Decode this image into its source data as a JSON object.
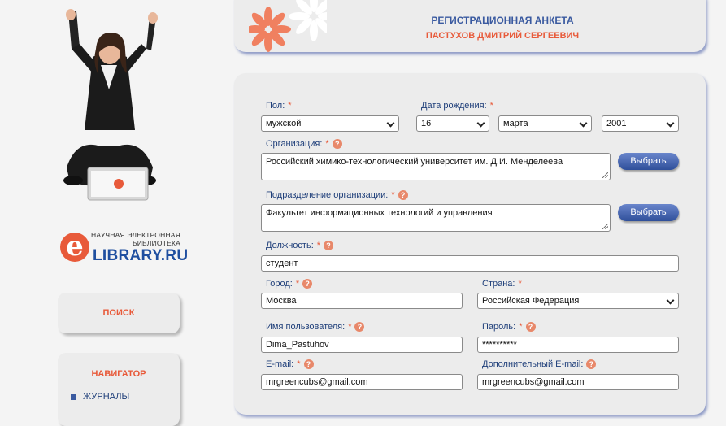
{
  "sidebar": {
    "logo_small_line1": "НАУЧНАЯ ЭЛЕКТРОННАЯ",
    "logo_small_line2": "БИБЛИОТЕКА",
    "logo_brand": "LIBRARY.RU",
    "logo_letter": "e",
    "search_title": "ПОИСК",
    "navigator_title": "НАВИГАТОР",
    "nav_items": [
      {
        "label": "ЖУРНАЛЫ"
      }
    ]
  },
  "header": {
    "title": "РЕГИСТРАЦИОННАЯ АНКЕТА",
    "name": "ПАСТУХОВ ДМИТРИЙ СЕРГЕЕВИЧ"
  },
  "form": {
    "gender_label": "Пол:",
    "gender_value": "мужской",
    "birthdate_label": "Дата рождения:",
    "birth_day": "16",
    "birth_month": "марта",
    "birth_year": "2001",
    "org_label": "Организация:",
    "org_value": "Российский химико-технологический университет им. Д.И. Менделеева",
    "dept_label": "Подразделение организации:",
    "dept_value": "Факультет информационных технологий и управления",
    "select_button": "Выбрать",
    "position_label": "Должность:",
    "position_value": "студент",
    "city_label": "Город:",
    "city_value": "Москва",
    "country_label": "Страна:",
    "country_value": "Российская Федерация",
    "username_label": "Имя пользователя:",
    "username_value": "Dima_Pastuhov",
    "password_label": "Пароль:",
    "password_value": "**********",
    "email_label": "E-mail:",
    "email_value": "mrgreencubs@gmail.com",
    "extra_email_label": "Дополнительный E-mail:",
    "extra_email_value": "mrgreencubs@gmail.com",
    "required_mark": "*",
    "help_mark": "?"
  },
  "colors": {
    "accent_orange": "#e85a3a",
    "label_blue": "#1f3f7a",
    "button_blue": "#2f4f9a"
  }
}
